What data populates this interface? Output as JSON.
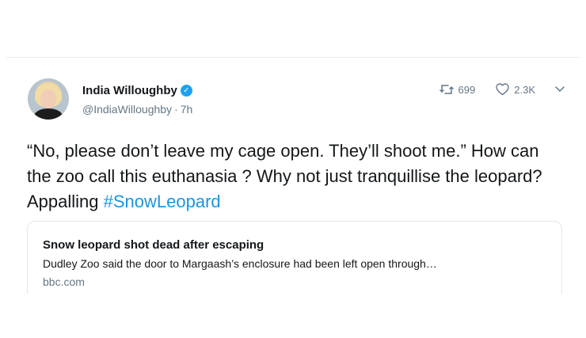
{
  "tweet": {
    "author": {
      "name": "India Willoughby",
      "handle": "@IndiaWilloughby",
      "time": "7h",
      "verified_icon": "verified-badge-icon"
    },
    "stats": {
      "retweets": "699",
      "likes": "2.3K"
    },
    "text": {
      "body": "“No, please don’t leave my cage open. They’ll shoot me.” How can the zoo call this euthanasia ? Why not just tranquillise the leopard? Appalling ",
      "hashtag": "#SnowLeopard"
    },
    "card": {
      "title": "Snow leopard shot dead after escaping",
      "description": "Dudley Zoo said the door to Margaash’s enclosure had been left open through…",
      "domain": "bbc.com"
    }
  },
  "colors": {
    "text": "#14171a",
    "secondary": "#657786",
    "accent": "#1da1f2",
    "hashtag": "#1b95e0",
    "border": "#e1e8ed"
  }
}
